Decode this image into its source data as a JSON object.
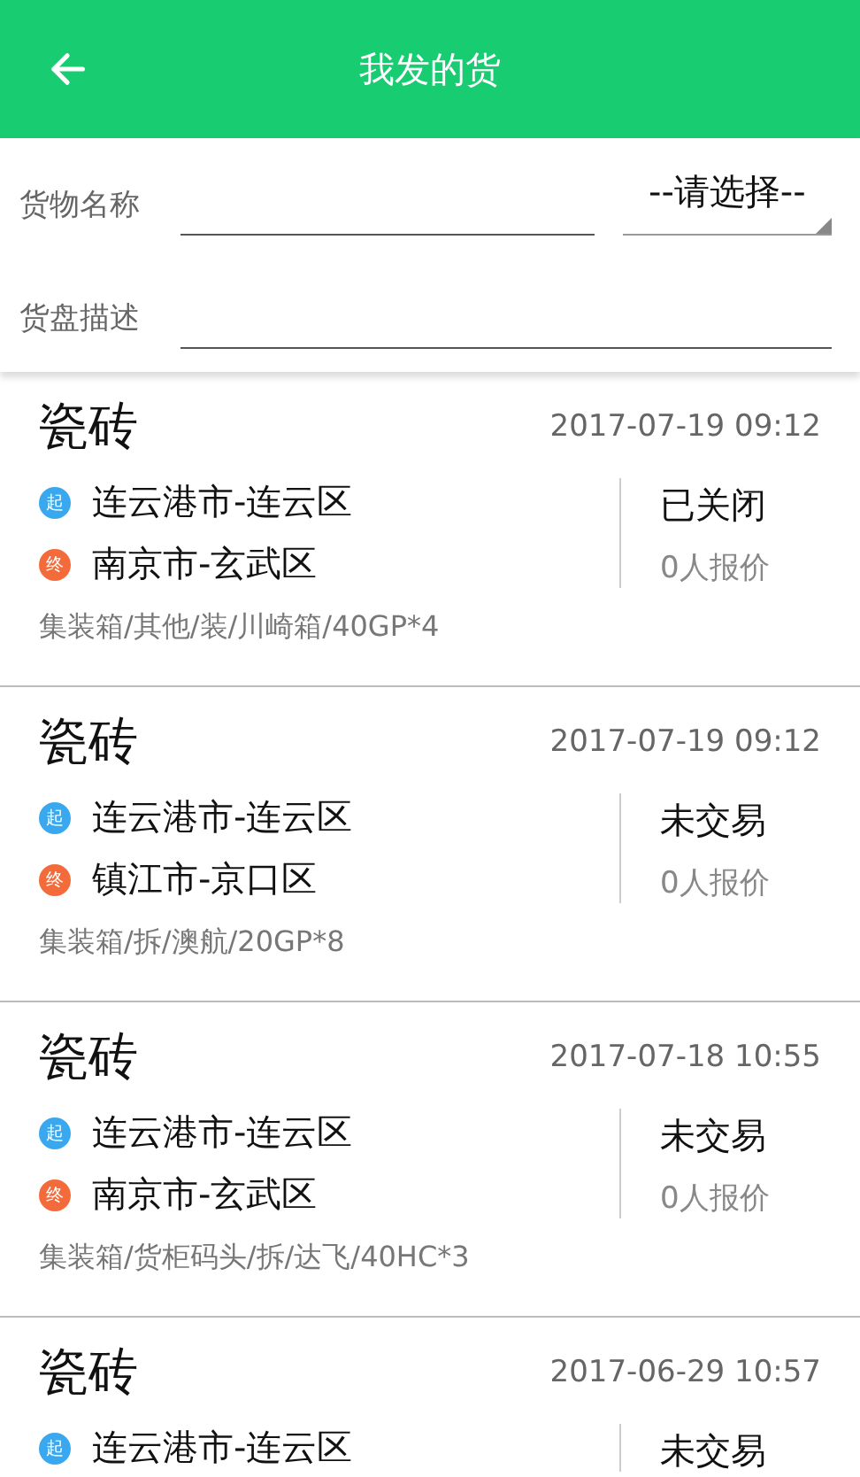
{
  "header": {
    "title": "我发的货"
  },
  "filters": {
    "name_label": "货物名称",
    "select": "--请选择--",
    "desc_label": "货盘描述"
  },
  "cards": [
    {
      "title": "瓷砖",
      "time": "2017-07-19 09:12",
      "origin_mark": "起",
      "origin": "连云港市-连云区",
      "dest_mark": "终",
      "dest": "南京市-玄武区",
      "status": "已关闭",
      "quotes": "0人报价",
      "spec": "集装箱/其他/装/川崎箱/40GP*4"
    },
    {
      "title": "瓷砖",
      "time": "2017-07-19 09:12",
      "origin_mark": "起",
      "origin": "连云港市-连云区",
      "dest_mark": "终",
      "dest": "镇江市-京口区",
      "status": "未交易",
      "quotes": "0人报价",
      "spec": "集装箱/拆/澳航/20GP*8"
    },
    {
      "title": "瓷砖",
      "time": "2017-07-18 10:55",
      "origin_mark": "起",
      "origin": "连云港市-连云区",
      "dest_mark": "终",
      "dest": "南京市-玄武区",
      "status": "未交易",
      "quotes": "0人报价",
      "spec": "集装箱/货柜码头/拆/达飞/40HC*3"
    },
    {
      "title": "瓷砖",
      "time": "2017-06-29 10:57",
      "origin_mark": "起",
      "origin": "连云港市-连云区",
      "status": "未交易"
    }
  ]
}
